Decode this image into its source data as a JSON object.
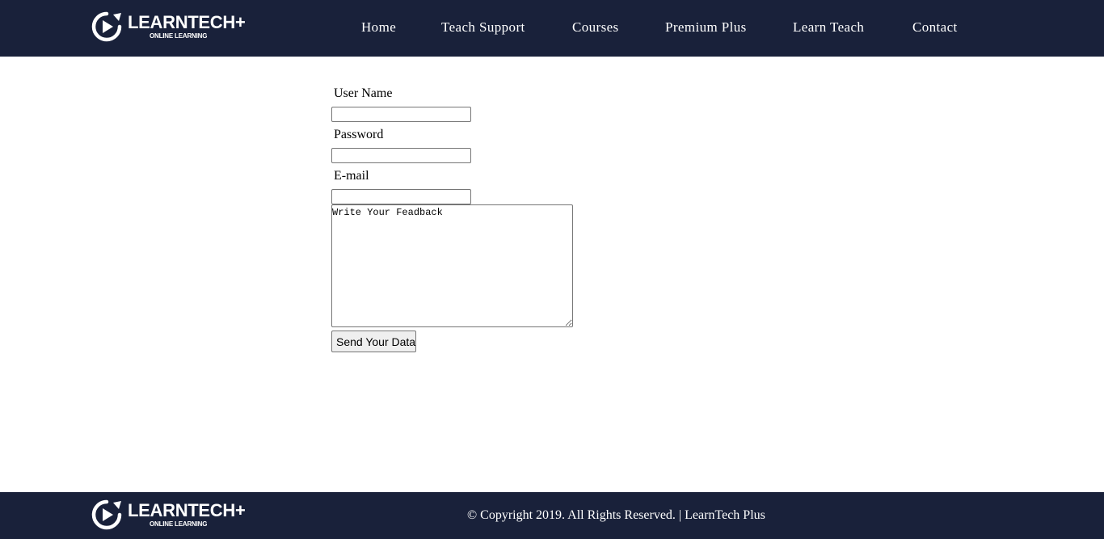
{
  "brand": {
    "name": "LEARNTECH+",
    "tagline": "ONLINE LEARNING",
    "logo_icon": "play-circle-icon"
  },
  "nav": {
    "items": [
      {
        "label": "Home"
      },
      {
        "label": "Teach Support"
      },
      {
        "label": "Courses"
      },
      {
        "label": "Premium Plus"
      },
      {
        "label": "Learn Teach"
      },
      {
        "label": "Contact"
      }
    ]
  },
  "form": {
    "username_label": "User Name",
    "username_value": "",
    "password_label": "Password",
    "password_value": "",
    "email_label": "E-mail",
    "email_value": "",
    "feedback_placeholder": "Write Your Feadback",
    "submit_label": "Send Your Data"
  },
  "footer": {
    "copyright": "© Copyright 2019. All Rights Reserved. | LearnTech Plus"
  },
  "colors": {
    "header_bg": "#19213a",
    "footer_bg": "#19213a",
    "nav_text": "#ffffff"
  }
}
